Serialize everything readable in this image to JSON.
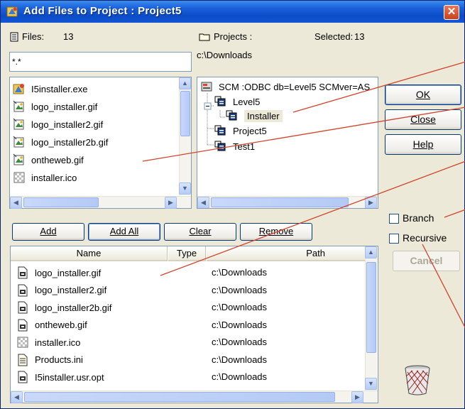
{
  "window": {
    "title": "Add Files to Project : Project5",
    "close_glyph": "✕"
  },
  "files": {
    "label": "Files:",
    "count": "13",
    "filter": "*.*",
    "items": [
      {
        "name": "I5installer.exe",
        "icon": "installer-exe-icon"
      },
      {
        "name": "logo_installer.gif",
        "icon": "gif-image-icon"
      },
      {
        "name": "logo_installer2.gif",
        "icon": "gif-image-icon"
      },
      {
        "name": "logo_installer2b.gif",
        "icon": "gif-image-icon"
      },
      {
        "name": "ontheweb.gif",
        "icon": "gif-image-icon"
      },
      {
        "name": "installer.ico",
        "icon": "ico-file-icon"
      }
    ]
  },
  "projects": {
    "label": "Projects :",
    "selected_label": "Selected:",
    "selected_count": "13",
    "path": "c:\\Downloads",
    "tree": [
      {
        "label": "SCM :ODBC db=Level5 SCMver=AS",
        "icon": "database-icon"
      },
      {
        "label": "Level5",
        "icon": "project-icon",
        "expander": "−"
      },
      {
        "label": "Installer",
        "icon": "project-icon",
        "selected": true
      },
      {
        "label": "Project5",
        "icon": "project-icon"
      },
      {
        "label": "Test1",
        "icon": "project-icon"
      }
    ]
  },
  "buttons": {
    "add": "Add",
    "add_all": "Add All",
    "clear": "Clear",
    "remove": "Remove",
    "ok": "OK",
    "close": "Close",
    "help": "Help",
    "cancel": "Cancel"
  },
  "options": {
    "branch": "Branch",
    "recursive": "Recursive"
  },
  "table": {
    "columns": [
      "Name",
      "Type",
      "Path"
    ],
    "rows": [
      {
        "name": "logo_installer.gif",
        "type": "",
        "path": "c:\\Downloads",
        "icon": "gif-file-icon"
      },
      {
        "name": "logo_installer2.gif",
        "type": "",
        "path": "c:\\Downloads",
        "icon": "gif-file-icon"
      },
      {
        "name": "logo_installer2b.gif",
        "type": "",
        "path": "c:\\Downloads",
        "icon": "gif-file-icon"
      },
      {
        "name": "ontheweb.gif",
        "type": "",
        "path": "c:\\Downloads",
        "icon": "gif-file-icon"
      },
      {
        "name": "installer.ico",
        "type": "",
        "path": "c:\\Downloads",
        "icon": "ico-file-icon"
      },
      {
        "name": "Products.ini",
        "type": "",
        "path": "c:\\Downloads",
        "icon": "ini-file-icon"
      },
      {
        "name": "I5installer.usr.opt",
        "type": "",
        "path": "c:\\Downloads",
        "icon": "gif-file-icon"
      }
    ]
  },
  "colors": {
    "titlebar": "#0b4cc8",
    "dialog_bg": "#ece9d8",
    "selection": "#ece9d8",
    "annotation": "#d0442c"
  }
}
